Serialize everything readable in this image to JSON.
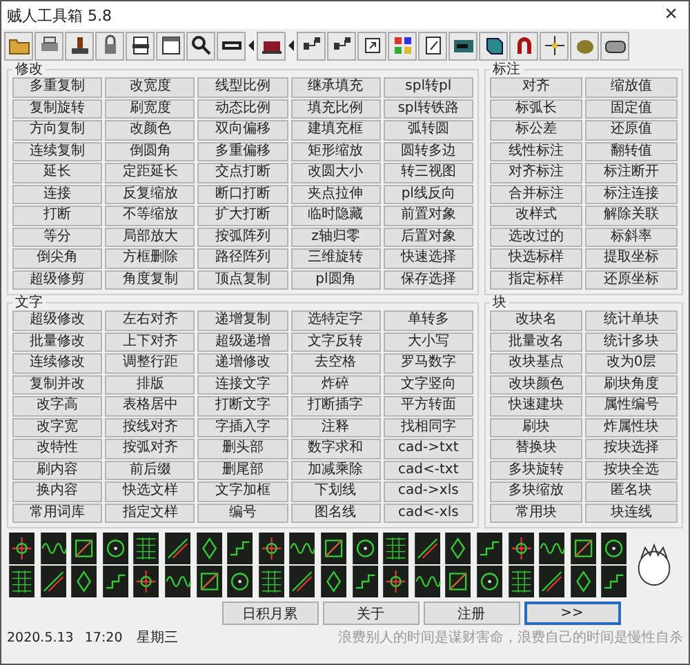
{
  "window": {
    "title": "贼人工具箱 5.8",
    "close": "×"
  },
  "groups": [
    {
      "title": "修改",
      "rows": [
        [
          "多重复制",
          "改宽度",
          "线型比例",
          "继承填充",
          "spl转pl"
        ],
        [
          "复制旋转",
          "刷宽度",
          "动态比例",
          "填充比例",
          "spl转铁路"
        ],
        [
          "方向复制",
          "改颜色",
          "双向偏移",
          "建填充框",
          "弧转圆"
        ],
        [
          "连续复制",
          "倒圆角",
          "多重偏移",
          "矩形缩放",
          "圆转多边"
        ],
        [
          "延长",
          "定距延长",
          "交点打断",
          "改圆大小",
          "转三视图"
        ],
        [
          "连接",
          "反复缩放",
          "断口打断",
          "夹点拉伸",
          "pl线反向"
        ],
        [
          "打断",
          "不等缩放",
          "扩大打断",
          "临时隐藏",
          "前置对象"
        ],
        [
          "等分",
          "局部放大",
          "按弧阵列",
          "z轴归零",
          "后置对象"
        ],
        [
          "倒尖角",
          "方框删除",
          "路径阵列",
          "三维旋转",
          "快速选择"
        ],
        [
          "超级修剪",
          "角度复制",
          "顶点复制",
          "pl圆角",
          "保存选择"
        ]
      ]
    },
    {
      "title": "标注",
      "rows": [
        [
          "对齐",
          "缩放值"
        ],
        [
          "标弧长",
          "固定值"
        ],
        [
          "标公差",
          "还原值"
        ],
        [
          "线性标注",
          "翻转值"
        ],
        [
          "对齐标注",
          "标注断开"
        ],
        [
          "合并标注",
          "标注连接"
        ],
        [
          "改样式",
          "解除关联"
        ],
        [
          "选改过的",
          "标斜率"
        ],
        [
          "快选标样",
          "提取坐标"
        ],
        [
          "指定标样",
          "还原坐标"
        ]
      ]
    },
    {
      "title": "文字",
      "rows": [
        [
          "超级修改",
          "左右对齐",
          "递增复制",
          "选特定字",
          "单转多"
        ],
        [
          "批量修改",
          "上下对齐",
          "超级递增",
          "文字反转",
          "大小写"
        ],
        [
          "连续修改",
          "调整行距",
          "递增修改",
          "去空格",
          "罗马数字"
        ],
        [
          "复制并改",
          "排版",
          "连接文字",
          "炸碎",
          "文字竖向"
        ],
        [
          "改字高",
          "表格居中",
          "打断文字",
          "打断插字",
          "平方转面"
        ],
        [
          "改字宽",
          "按线对齐",
          "字插入字",
          "注释",
          "找相同字"
        ],
        [
          "改特性",
          "按弧对齐",
          "删头部",
          "数字求和",
          "cad->txt"
        ],
        [
          "刷内容",
          "前后缀",
          "删尾部",
          "加减乘除",
          "cad<-txt"
        ],
        [
          "换内容",
          "快选文样",
          "文字加框",
          "下划线",
          "cad->xls"
        ],
        [
          "常用词库",
          "指定文样",
          "编号",
          "图名线",
          "cad<-xls"
        ]
      ]
    },
    {
      "title": "块",
      "rows": [
        [
          "改块名",
          "统计单块"
        ],
        [
          "批量改名",
          "统计多块"
        ],
        [
          "改块基点",
          "改为0层"
        ],
        [
          "改块颜色",
          "刷块角度"
        ],
        [
          "快速建块",
          "属性编号"
        ],
        [
          "刷块",
          "炸属性块"
        ],
        [
          "替换块",
          "按块选择"
        ],
        [
          "多块旋转",
          "按块全选"
        ],
        [
          "多块缩放",
          "匿名块"
        ],
        [
          "常用块",
          "块连线"
        ]
      ]
    }
  ],
  "bottom_buttons": [
    {
      "label": "日积月累",
      "default": false
    },
    {
      "label": "关于",
      "default": false
    },
    {
      "label": "注册",
      "default": false
    },
    {
      "label": ">>",
      "default": true
    }
  ],
  "status": {
    "date": "2020.5.13",
    "time": "17:20",
    "weekday": "星期三",
    "quote": "浪费别人的时间是谋财害命，浪费自己的时间是慢性自杀"
  }
}
